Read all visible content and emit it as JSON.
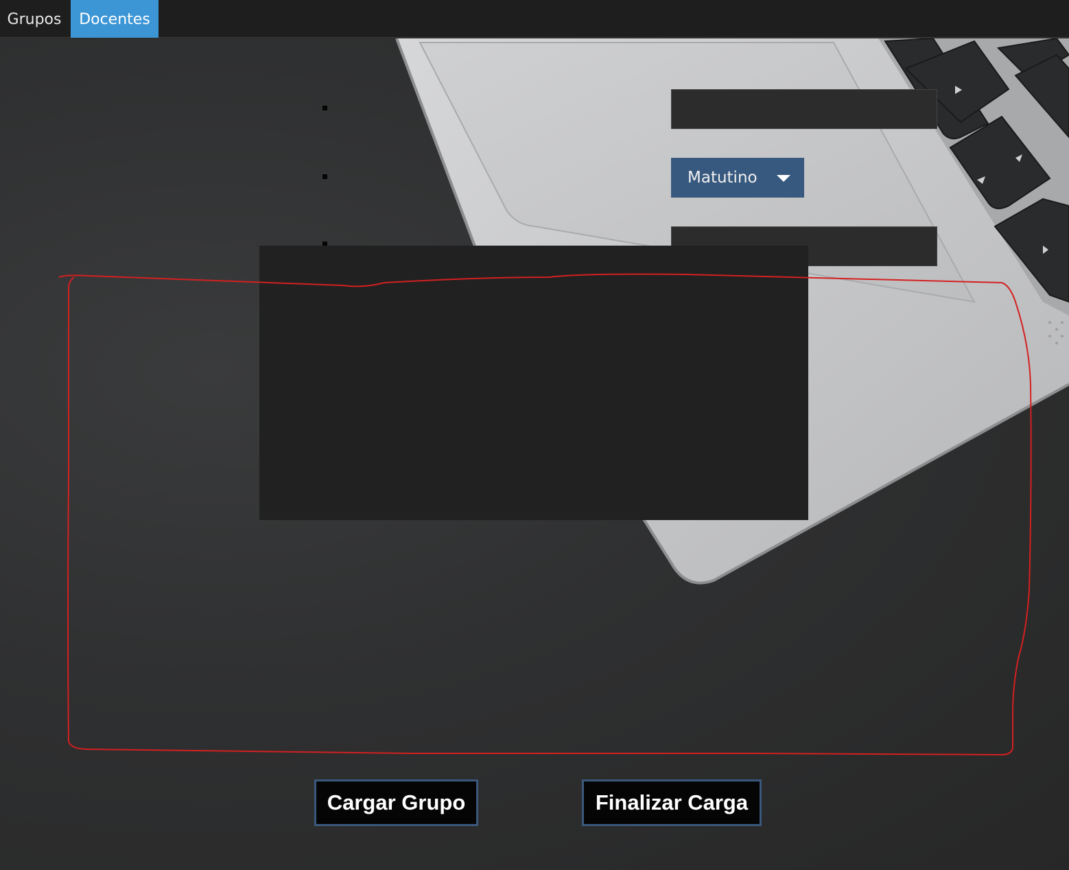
{
  "tabs": [
    {
      "label": "Grupos",
      "selected": false
    },
    {
      "label": "Docentes",
      "selected": true
    }
  ],
  "form": {
    "field_top_value": "",
    "shift_select": {
      "selected": "Matutino"
    },
    "field_bottom_value": ""
  },
  "buttons": {
    "load_group": "Cargar Grupo",
    "finish_load": "Finalizar Carga"
  },
  "colors": {
    "active_tab": "#3c96d6",
    "combo_bg": "#38597f",
    "button_border": "#3a587d",
    "annotation_stroke": "#d42020"
  }
}
